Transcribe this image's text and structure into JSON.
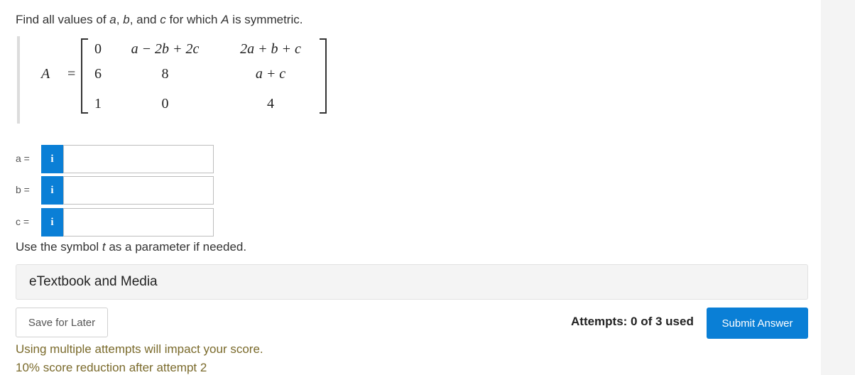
{
  "question": {
    "prefix": "Find all values of ",
    "var_a": "a",
    "sep1": ", ",
    "var_b": "b",
    "sep2": ", and ",
    "var_c": "c",
    "mid": " for which ",
    "var_A": "A",
    "suffix": " is symmetric."
  },
  "matrix": {
    "label": "A",
    "equals": "=",
    "rows": [
      [
        "0",
        "a − 2b + 2c",
        "2a + b + c"
      ],
      [
        "6",
        "8",
        "a + c"
      ],
      [
        "1",
        "0",
        "4"
      ]
    ]
  },
  "answers": [
    {
      "var": "a",
      "label": "a =",
      "info_icon": "i",
      "value": ""
    },
    {
      "var": "b",
      "label": "b =",
      "info_icon": "i",
      "value": ""
    },
    {
      "var": "c",
      "label": "c =",
      "info_icon": "i",
      "value": ""
    }
  ],
  "hint": {
    "prefix": "Use the symbol ",
    "symbol": "t",
    "suffix": " as a parameter if needed."
  },
  "etextbook_label": "eTextbook and Media",
  "save_label": "Save for Later",
  "attempts_text": "Attempts: 0 of 3 used",
  "submit_label": "Submit Answer",
  "warning_line1": "Using multiple attempts will impact your score.",
  "warning_line2": "10% score reduction after attempt 2",
  "colors": {
    "primary_blue": "#0a7fd6",
    "warning_text": "#7a6a2b"
  }
}
